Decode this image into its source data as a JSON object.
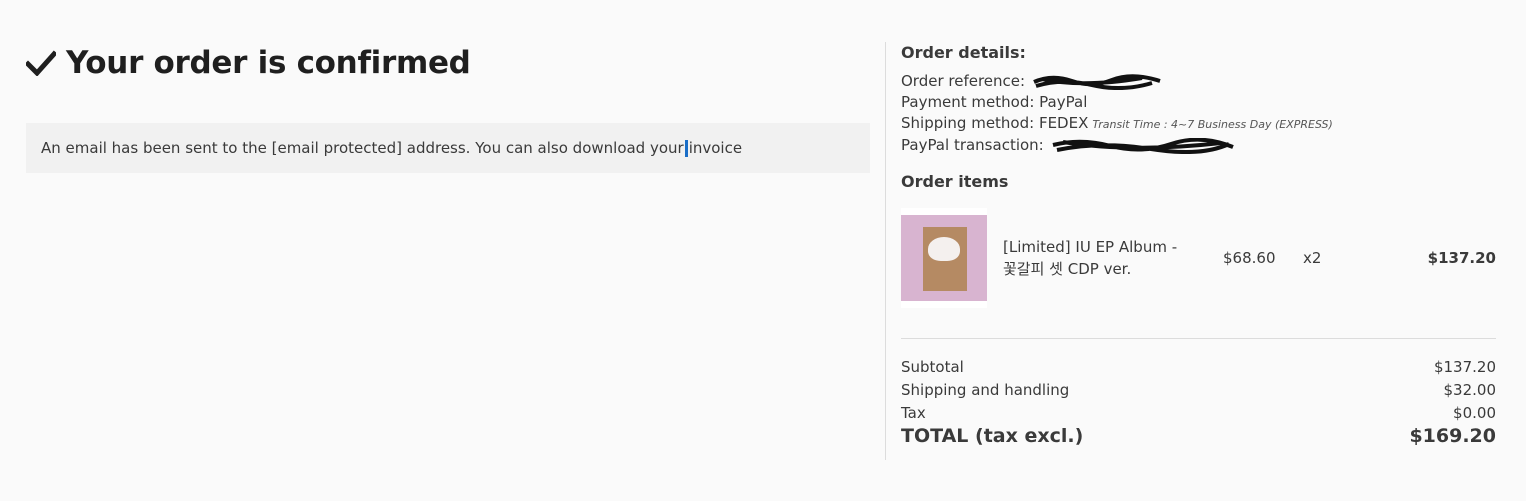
{
  "confirmation": {
    "title": "Your order is confirmed",
    "notice_text": "An email has been sent to the [email protected] address. You can also download your",
    "notice_link": "invoice"
  },
  "order_details": {
    "heading": "Order details:",
    "reference_label": "Order reference:",
    "payment_label": "Payment method: PayPal",
    "shipping_label": "Shipping method: FEDEX",
    "shipping_transit": "Transit Time : 4~7 Business Day (EXPRESS)",
    "paypal_label": "PayPal transaction:"
  },
  "order_items": {
    "heading": "Order items",
    "items": [
      {
        "name_line1": "[Limited] IU EP Album -",
        "name_line2": "꽃갈피 셋 CDP ver.",
        "unit_price": "$68.60",
        "quantity": "x2",
        "total": "$137.20"
      }
    ]
  },
  "totals": {
    "subtotal_label": "Subtotal",
    "subtotal_value": "$137.20",
    "shipping_label": "Shipping and handling",
    "shipping_value": "$32.00",
    "tax_label": "Tax",
    "tax_value": "$0.00",
    "total_label": "TOTAL (tax excl.)",
    "total_value": "$169.20"
  }
}
